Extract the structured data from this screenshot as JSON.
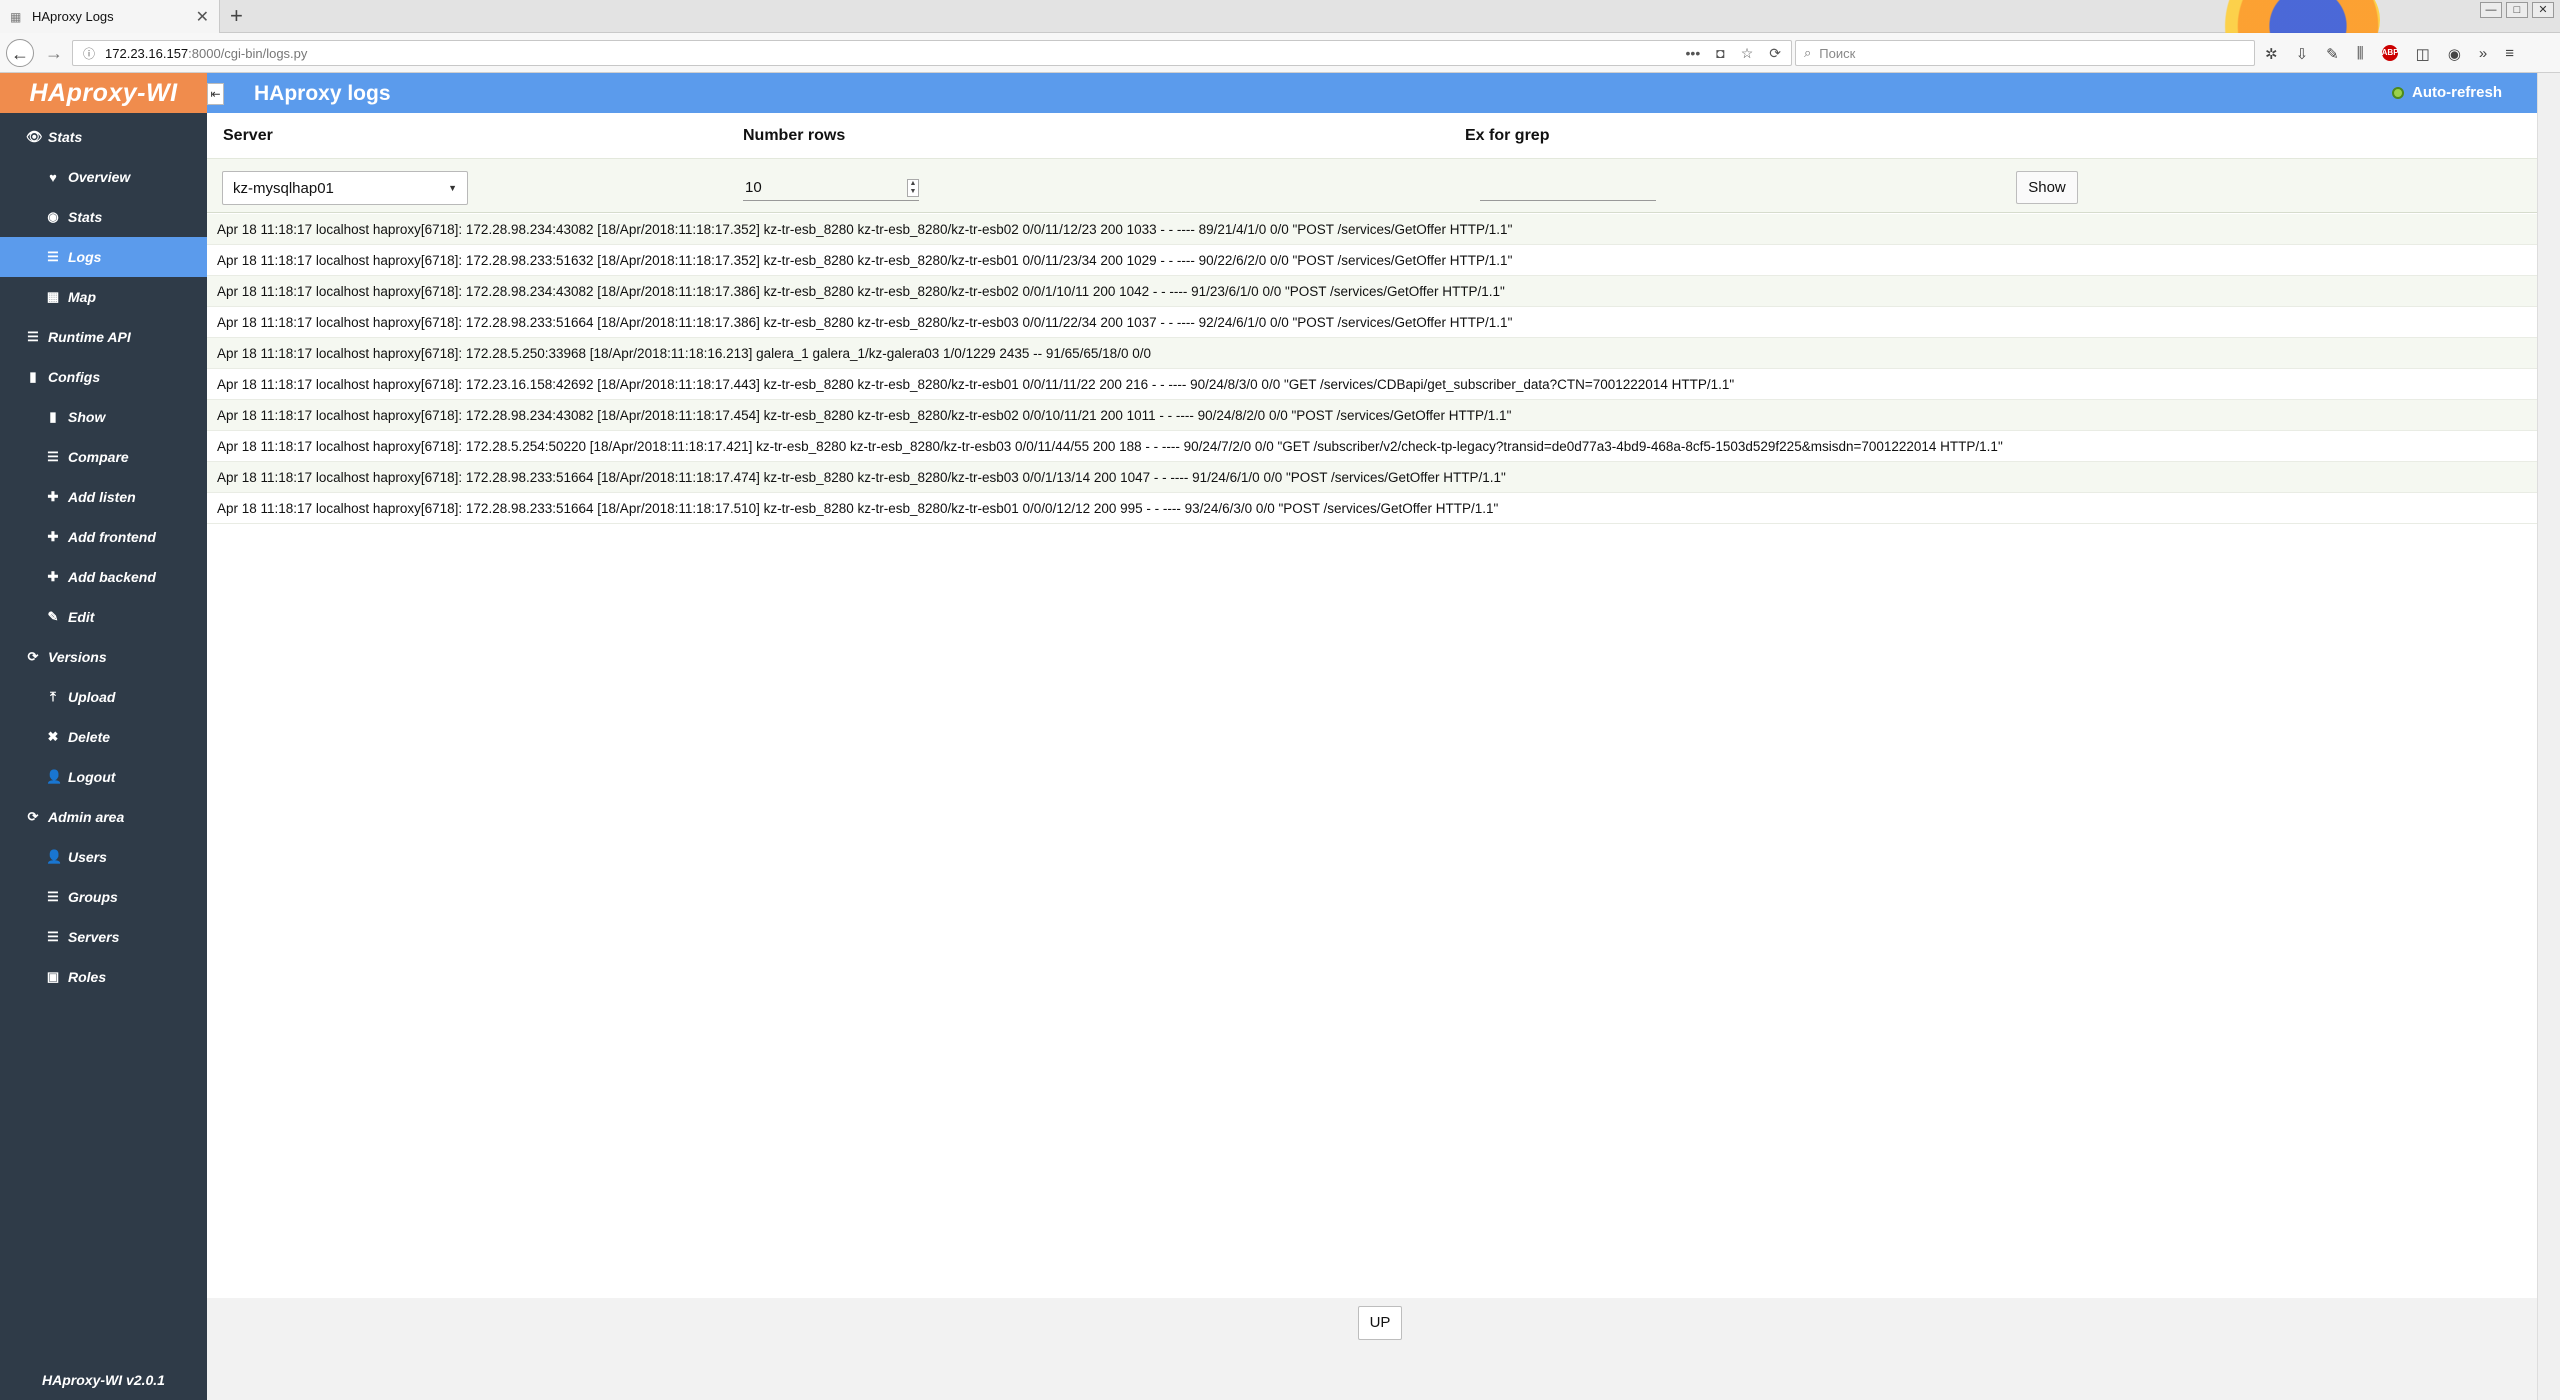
{
  "browser": {
    "tab_title": "HAproxy Logs",
    "tab_close": "✕",
    "new_tab": "+",
    "url_host": "172.23.16.157",
    "url_path": ":8000/cgi-bin/logs.py",
    "url_info_icon": "ⓘ",
    "page_actions": "•••",
    "search_placeholder": "Поиск",
    "window_buttons": [
      "—",
      "□",
      "✕"
    ]
  },
  "sidebar": {
    "logo": "HAproxy-WI",
    "version": "HAproxy-WI v2.0.1",
    "items": [
      {
        "label": "Stats",
        "icon": "eye-icon",
        "glyph": "👁",
        "sub": false,
        "active": false
      },
      {
        "label": "Overview",
        "icon": "heart-icon",
        "glyph": "♥",
        "sub": true,
        "active": false
      },
      {
        "label": "Stats",
        "icon": "eye-icon",
        "glyph": "◉",
        "sub": true,
        "active": false
      },
      {
        "label": "Logs",
        "icon": "list-icon",
        "glyph": "☰",
        "sub": true,
        "active": true
      },
      {
        "label": "Map",
        "icon": "map-icon",
        "glyph": "▦",
        "sub": true,
        "active": false
      },
      {
        "label": "Runtime API",
        "icon": "list-icon",
        "glyph": "☰",
        "sub": false,
        "active": false
      },
      {
        "label": "Configs",
        "icon": "file-icon",
        "glyph": "▮",
        "sub": false,
        "active": false
      },
      {
        "label": "Show",
        "icon": "file-icon",
        "glyph": "▮",
        "sub": true,
        "active": false
      },
      {
        "label": "Compare",
        "icon": "list-icon",
        "glyph": "☰",
        "sub": true,
        "active": false
      },
      {
        "label": "Add listen",
        "icon": "plus-icon",
        "glyph": "✚",
        "sub": true,
        "active": false
      },
      {
        "label": "Add frontend",
        "icon": "plus-icon",
        "glyph": "✚",
        "sub": true,
        "active": false
      },
      {
        "label": "Add backend",
        "icon": "plus-icon",
        "glyph": "✚",
        "sub": true,
        "active": false
      },
      {
        "label": "Edit",
        "icon": "edit-icon",
        "glyph": "✎",
        "sub": true,
        "active": false
      },
      {
        "label": "Versions",
        "icon": "refresh-icon",
        "glyph": "⟳",
        "sub": false,
        "active": false
      },
      {
        "label": "Upload",
        "icon": "upload-icon",
        "glyph": "⤒",
        "sub": true,
        "active": false
      },
      {
        "label": "Delete",
        "icon": "close-icon",
        "glyph": "✖",
        "sub": true,
        "active": false
      },
      {
        "label": "Logout",
        "icon": "user-icon",
        "glyph": "👤",
        "sub": true,
        "active": false
      },
      {
        "label": "Admin area",
        "icon": "refresh-icon",
        "glyph": "⟳",
        "sub": false,
        "active": false
      },
      {
        "label": "Users",
        "icon": "add-user-icon",
        "glyph": "👤",
        "sub": true,
        "active": false
      },
      {
        "label": "Groups",
        "icon": "list-icon",
        "glyph": "☰",
        "sub": true,
        "active": false
      },
      {
        "label": "Servers",
        "icon": "list-icon",
        "glyph": "☰",
        "sub": true,
        "active": false
      },
      {
        "label": "Roles",
        "icon": "id-card-icon",
        "glyph": "▣",
        "sub": true,
        "active": false
      }
    ]
  },
  "header": {
    "collapse": "⇤",
    "title": "HAproxy logs",
    "auto_refresh": "Auto-refresh"
  },
  "form": {
    "server_label": "Server",
    "rows_label": "Number rows",
    "grep_label": "Ex for grep",
    "server_value": "kz-mysqlhap01",
    "rows_value": "10",
    "grep_value": "",
    "show_label": "Show"
  },
  "logs": [
    "Apr 18 11:18:17 localhost haproxy[6718]: 172.28.98.234:43082 [18/Apr/2018:11:18:17.352] kz-tr-esb_8280 kz-tr-esb_8280/kz-tr-esb02 0/0/11/12/23 200 1033 - - ---- 89/21/4/1/0 0/0 \"POST /services/GetOffer HTTP/1.1\"",
    "Apr 18 11:18:17 localhost haproxy[6718]: 172.28.98.233:51632 [18/Apr/2018:11:18:17.352] kz-tr-esb_8280 kz-tr-esb_8280/kz-tr-esb01 0/0/11/23/34 200 1029 - - ---- 90/22/6/2/0 0/0 \"POST /services/GetOffer HTTP/1.1\"",
    "Apr 18 11:18:17 localhost haproxy[6718]: 172.28.98.234:43082 [18/Apr/2018:11:18:17.386] kz-tr-esb_8280 kz-tr-esb_8280/kz-tr-esb02 0/0/1/10/11 200 1042 - - ---- 91/23/6/1/0 0/0 \"POST /services/GetOffer HTTP/1.1\"",
    "Apr 18 11:18:17 localhost haproxy[6718]: 172.28.98.233:51664 [18/Apr/2018:11:18:17.386] kz-tr-esb_8280 kz-tr-esb_8280/kz-tr-esb03 0/0/11/22/34 200 1037 - - ---- 92/24/6/1/0 0/0 \"POST /services/GetOffer HTTP/1.1\"",
    "Apr 18 11:18:17 localhost haproxy[6718]: 172.28.5.250:33968 [18/Apr/2018:11:18:16.213] galera_1 galera_1/kz-galera03 1/0/1229 2435 -- 91/65/65/18/0 0/0",
    "Apr 18 11:18:17 localhost haproxy[6718]: 172.23.16.158:42692 [18/Apr/2018:11:18:17.443] kz-tr-esb_8280 kz-tr-esb_8280/kz-tr-esb01 0/0/11/11/22 200 216 - - ---- 90/24/8/3/0 0/0 \"GET /services/CDBapi/get_subscriber_data?CTN=7001222014 HTTP/1.1\"",
    "Apr 18 11:18:17 localhost haproxy[6718]: 172.28.98.234:43082 [18/Apr/2018:11:18:17.454] kz-tr-esb_8280 kz-tr-esb_8280/kz-tr-esb02 0/0/10/11/21 200 1011 - - ---- 90/24/8/2/0 0/0 \"POST /services/GetOffer HTTP/1.1\"",
    "Apr 18 11:18:17 localhost haproxy[6718]: 172.28.5.254:50220 [18/Apr/2018:11:18:17.421] kz-tr-esb_8280 kz-tr-esb_8280/kz-tr-esb03 0/0/11/44/55 200 188 - - ---- 90/24/7/2/0 0/0 \"GET /subscriber/v2/check-tp-legacy?transid=de0d77a3-4bd9-468a-8cf5-1503d529f225&msisdn=7001222014 HTTP/1.1\"",
    "Apr 18 11:18:17 localhost haproxy[6718]: 172.28.98.233:51664 [18/Apr/2018:11:18:17.474] kz-tr-esb_8280 kz-tr-esb_8280/kz-tr-esb03 0/0/1/13/14 200 1047 - - ---- 91/24/6/1/0 0/0 \"POST /services/GetOffer HTTP/1.1\"",
    "Apr 18 11:18:17 localhost haproxy[6718]: 172.28.98.233:51664 [18/Apr/2018:11:18:17.510] kz-tr-esb_8280 kz-tr-esb_8280/kz-tr-esb01 0/0/0/12/12 200 995 - - ---- 93/24/6/3/0 0/0 \"POST /services/GetOffer HTTP/1.1\""
  ],
  "footer": {
    "up_label": "UP"
  },
  "colors": {
    "sidebar_bg": "#2f3b48",
    "logo_bg": "#f08c4d",
    "accent_blue": "#5b9bec",
    "row_alt": "#f5f8f1"
  }
}
